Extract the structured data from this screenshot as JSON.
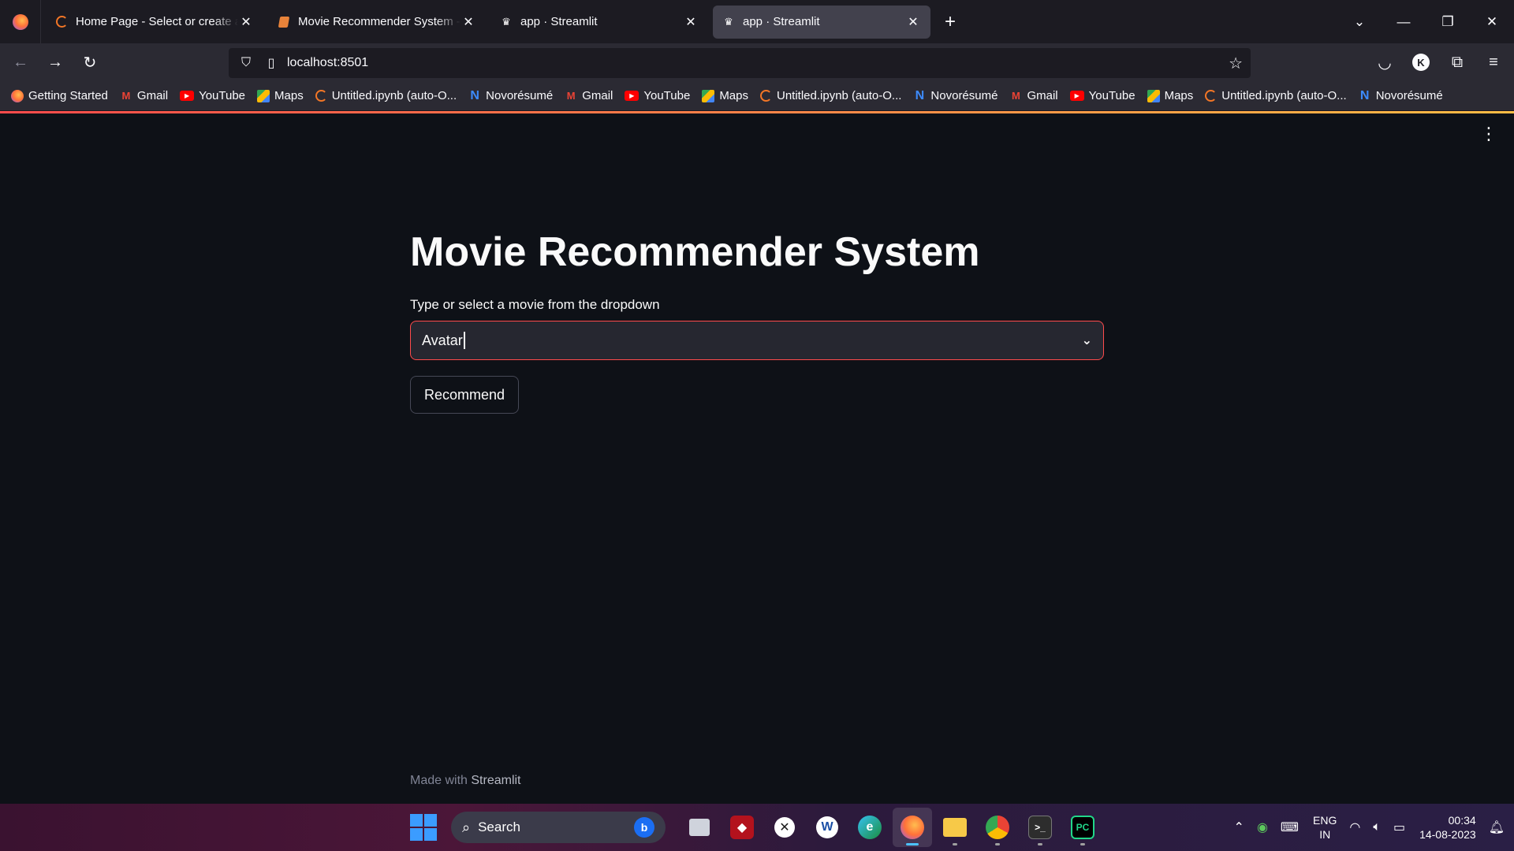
{
  "browser": {
    "tabs": [
      {
        "title": "Home Page - Select or create a notebook",
        "favicon": "jupyter-icon",
        "active": false
      },
      {
        "title": "Movie Recommender System - Jupyter",
        "favicon": "notebook-icon",
        "active": false
      },
      {
        "title": "app · Streamlit",
        "favicon": "streamlit-crown-icon",
        "active": false
      },
      {
        "title": "app · Streamlit",
        "favicon": "streamlit-crown-icon",
        "active": true
      }
    ],
    "url": "localhost:8501",
    "profile_initial": "K",
    "bookmarks": [
      {
        "label": "Getting Started",
        "icon": "firefox-icon"
      },
      {
        "label": "Gmail",
        "icon": "gmail-icon"
      },
      {
        "label": "YouTube",
        "icon": "youtube-icon"
      },
      {
        "label": "Maps",
        "icon": "maps-icon"
      },
      {
        "label": "Untitled.ipynb (auto-O...",
        "icon": "jupyter-icon"
      },
      {
        "label": "Novorésumé",
        "icon": "novoresume-icon"
      },
      {
        "label": "Gmail",
        "icon": "gmail-icon"
      },
      {
        "label": "YouTube",
        "icon": "youtube-icon"
      },
      {
        "label": "Maps",
        "icon": "maps-icon"
      },
      {
        "label": "Untitled.ipynb (auto-O...",
        "icon": "jupyter-icon"
      },
      {
        "label": "Novorésumé",
        "icon": "novoresume-icon"
      },
      {
        "label": "Gmail",
        "icon": "gmail-icon"
      },
      {
        "label": "YouTube",
        "icon": "youtube-icon"
      },
      {
        "label": "Maps",
        "icon": "maps-icon"
      },
      {
        "label": "Untitled.ipynb (auto-O...",
        "icon": "jupyter-icon"
      },
      {
        "label": "Novorésumé",
        "icon": "novoresume-icon"
      }
    ]
  },
  "app": {
    "title": "Movie Recommender System",
    "select_label": "Type or select a movie from the dropdown",
    "select_value": "Avatar",
    "button_label": "Recommend",
    "footer_prefix": "Made with",
    "footer_brand": "Streamlit",
    "accent_color": "#ff4b4b"
  },
  "taskbar": {
    "search_label": "Search",
    "apps": [
      "task-view-icon",
      "game-app-icon",
      "xbox-icon",
      "word-icon",
      "edge-icon",
      "firefox-icon",
      "file-explorer-icon",
      "chrome-icon",
      "terminal-icon",
      "pycharm-icon"
    ],
    "language": "ENG",
    "region": "IN",
    "time": "00:34",
    "date": "14-08-2023"
  }
}
